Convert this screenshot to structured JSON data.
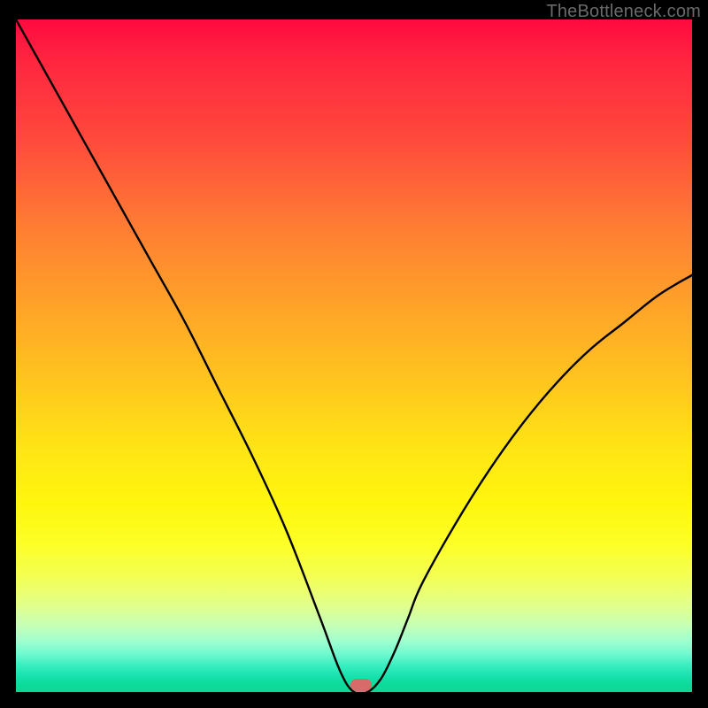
{
  "watermark": "TheBottleneck.com",
  "chart_data": {
    "type": "line",
    "title": "",
    "xlabel": "",
    "ylabel": "",
    "xlim": [
      0,
      100
    ],
    "ylim": [
      0,
      100
    ],
    "grid": false,
    "series": [
      {
        "name": "bottleneck-curve",
        "x": [
          0,
          5,
          10,
          15,
          20,
          25,
          30,
          35,
          40,
          45,
          48,
          50,
          52,
          54,
          56,
          58,
          60,
          65,
          70,
          75,
          80,
          85,
          90,
          95,
          100
        ],
        "values": [
          100,
          91,
          82,
          73,
          64,
          55,
          45,
          35,
          24,
          11,
          3,
          0,
          0,
          2,
          6,
          11,
          16,
          25,
          33,
          40,
          46,
          51,
          55,
          59,
          62
        ]
      }
    ],
    "annotations": [
      {
        "name": "min-marker",
        "x": 51,
        "y": 0.8,
        "color": "#d96a6a",
        "shape": "rounded-rect"
      }
    ],
    "background_gradient": {
      "orientation": "vertical",
      "stops": [
        {
          "pos": 0.0,
          "color": "#ff0a3f"
        },
        {
          "pos": 0.5,
          "color": "#ffc61e"
        },
        {
          "pos": 0.8,
          "color": "#fdff26"
        },
        {
          "pos": 0.95,
          "color": "#6cf8cf"
        },
        {
          "pos": 1.0,
          "color": "#0bd892"
        }
      ]
    }
  },
  "marker": {
    "left_pct": 51.0,
    "top_pct": 99.0
  }
}
